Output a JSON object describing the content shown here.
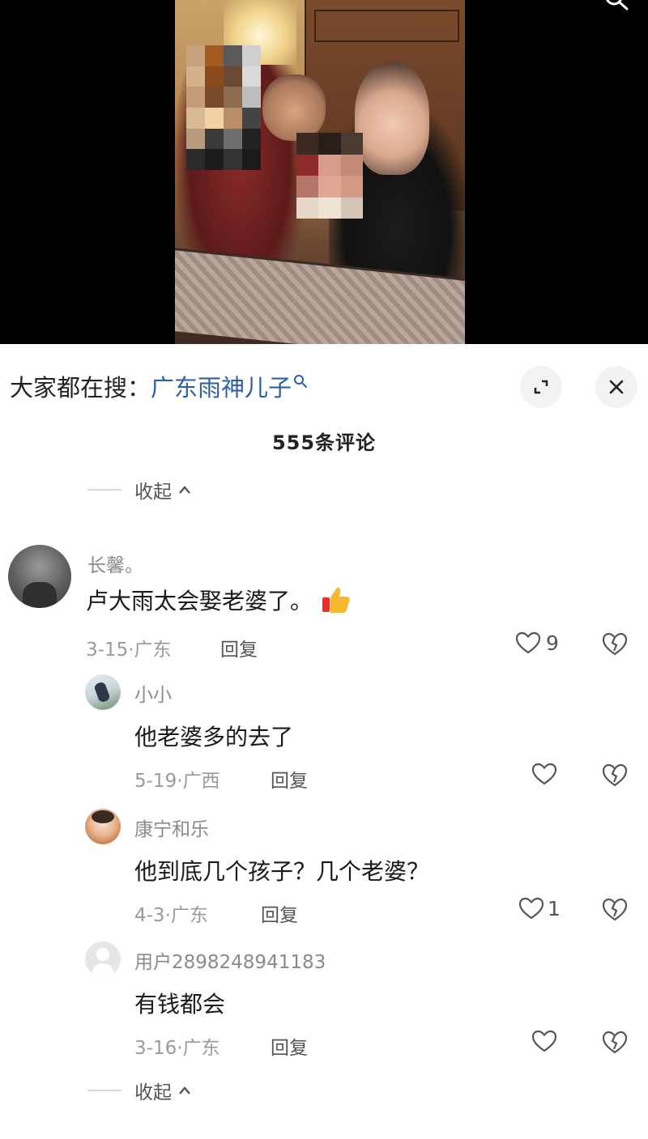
{
  "search_suggest": {
    "prefix": "大家都在搜：",
    "term": "广东雨神儿子",
    "icon": "search-icon"
  },
  "comment_count": "555条评论",
  "collapse_label": "收起",
  "reply_label": "回复",
  "comments": [
    {
      "name": "长馨。",
      "text": "卢大雨太会娶老婆了。",
      "emoji": "thumbs-up-icon",
      "date": "3-15",
      "region": "广东",
      "likes": "9"
    },
    {
      "name": "小小",
      "text": "他老婆多的去了",
      "date": "5-19",
      "region": "广西",
      "likes": ""
    },
    {
      "name": "康宁和乐",
      "text": "他到底几个孩子？几个老婆？",
      "date": "4-3",
      "region": "广东",
      "likes": "1"
    },
    {
      "name": "用户2898248941183",
      "text": "有钱都会",
      "date": "3-16",
      "region": "广东",
      "likes": ""
    }
  ],
  "colors": {
    "search_term": "#2e5fa3",
    "meta_gray": "#9a9a9a",
    "name_gray": "#8a8a8a"
  }
}
